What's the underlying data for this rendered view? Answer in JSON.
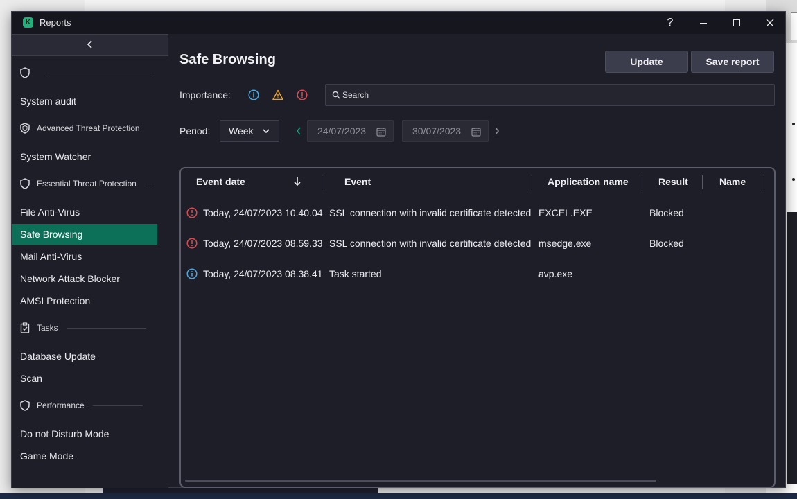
{
  "window": {
    "title": "Reports",
    "help": "?"
  },
  "sidebar": {
    "collapse_icon": "chevron-left-icon",
    "groups": [
      {
        "label": "",
        "icon": "shield-icon"
      },
      {
        "label": "Advanced Threat Protection",
        "icon": "shield-icon"
      },
      {
        "label": "Essential Threat Protection",
        "icon": "shield-icon"
      },
      {
        "label": "Tasks",
        "icon": "clipboard-check-icon"
      },
      {
        "label": "Performance",
        "icon": "shield-icon"
      }
    ],
    "items": [
      {
        "label": "System audit"
      },
      {
        "label": "System Watcher"
      },
      {
        "label": "File Anti-Virus"
      },
      {
        "label": "Safe Browsing",
        "active": true
      },
      {
        "label": "Mail Anti-Virus"
      },
      {
        "label": "Network Attack Blocker"
      },
      {
        "label": "AMSI Protection"
      },
      {
        "label": "Database Update"
      },
      {
        "label": "Scan"
      },
      {
        "label": "Do not Disturb Mode"
      },
      {
        "label": "Game Mode"
      }
    ]
  },
  "main": {
    "title": "Safe Browsing",
    "buttons": {
      "update": "Update",
      "save_report": "Save report"
    },
    "importance_label": "Importance:",
    "importance_icons": [
      "info-icon",
      "warning-icon",
      "error-icon"
    ],
    "search_placeholder": "Search",
    "period_label": "Period:",
    "period_value": "Week",
    "date_from": "24/07/2023",
    "date_to": "30/07/2023",
    "table": {
      "columns": [
        "Event date",
        "Event",
        "Application name",
        "Result",
        "Name"
      ],
      "sort_column": "Event date",
      "rows": [
        {
          "severity": "error",
          "date": "Today, 24/07/2023 10.40.04",
          "event": "SSL connection with invalid certificate detected",
          "app": "EXCEL.EXE",
          "result": "Blocked",
          "name": ""
        },
        {
          "severity": "error",
          "date": "Today, 24/07/2023 08.59.33",
          "event": "SSL connection with invalid certificate detected",
          "app": "msedge.exe",
          "result": "Blocked",
          "name": ""
        },
        {
          "severity": "info",
          "date": "Today, 24/07/2023 08.38.41",
          "event": "Task started",
          "app": "avp.exe",
          "result": "",
          "name": ""
        }
      ]
    }
  },
  "colors": {
    "accent": "#0c6f58",
    "info": "#4aa8e0",
    "warning": "#e8a32a",
    "error": "#e0484f",
    "background": "#1e1e28"
  }
}
